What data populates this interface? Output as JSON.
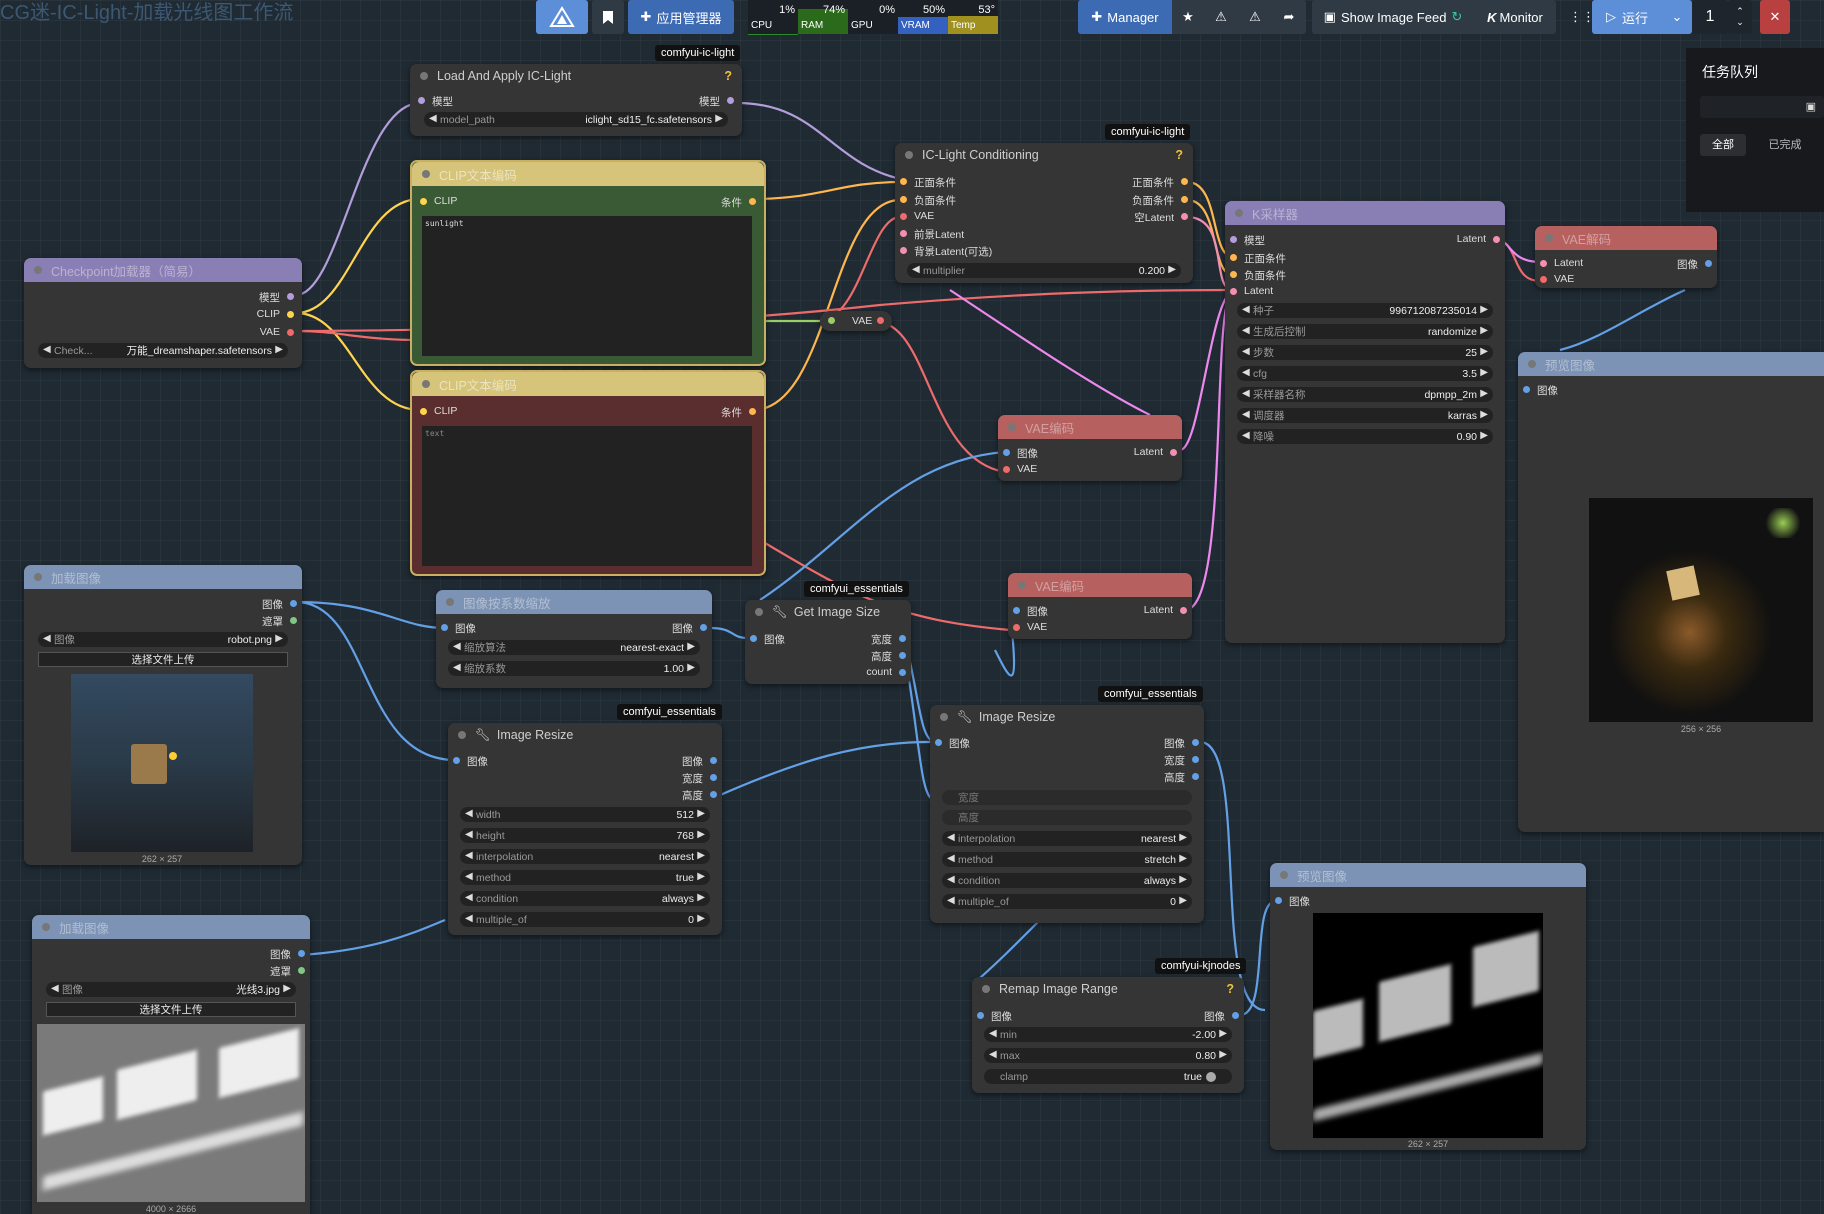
{
  "workflow_title": "CG迷-IC-Light-加载光线图工作流",
  "topbar": {
    "app_manager": "应用管理器",
    "stats": [
      {
        "label": "CPU",
        "value": "1%",
        "level": 0.01,
        "color": "#2a8a2a"
      },
      {
        "label": "RAM",
        "value": "74%",
        "level": 0.74,
        "color": "#2a7a2a"
      },
      {
        "label": "GPU",
        "value": "0%",
        "level": 0.0,
        "color": "#2a7a2a"
      },
      {
        "label": "VRAM",
        "value": "50%",
        "level": 0.5,
        "color": "#3460c0"
      },
      {
        "label": "Temp",
        "value": "53°",
        "level": 0.53,
        "color": "#a09020"
      }
    ],
    "manager": "Manager",
    "show_image_feed": "Show Image Feed",
    "monitor": "Monitor",
    "run": "运行",
    "queue_count": "1"
  },
  "queue_panel": {
    "title": "任务队列",
    "tab_all": "全部",
    "tab_done": "已完成"
  },
  "nodes": {
    "load_iclight": {
      "badge": "comfyui-ic-light",
      "title": "Load And Apply IC-Light",
      "in_model": "模型",
      "out_model": "模型",
      "w_name": "model_path",
      "w_value": "iclight_sd15_fc.safetensors"
    },
    "clip_pos": {
      "title": "CLIP文本编码",
      "in_clip": "CLIP",
      "out": "条件",
      "text": "sunlight"
    },
    "clip_neg": {
      "title": "CLIP文本编码",
      "in_clip": "CLIP",
      "out": "条件",
      "text": "text"
    },
    "checkpoint": {
      "title": "Checkpoint加载器（简易）",
      "out_model": "模型",
      "out_clip": "CLIP",
      "out_vae": "VAE",
      "w_name": "Check...",
      "w_value": "万能_dreamshaper.safetensors"
    },
    "iclight_cond": {
      "badge": "comfyui-ic-light",
      "title": "IC-Light Conditioning",
      "in_pos": "正面条件",
      "in_neg": "负面条件",
      "in_vae": "VAE",
      "in_fg": "前景Latent",
      "in_bg": "背景Latent(可选)",
      "out_pos": "正面条件",
      "out_neg": "负面条件",
      "out_empty": "空Latent",
      "w_name": "multiplier",
      "w_value": "0.200"
    },
    "reroute_vae": {
      "label": "VAE"
    },
    "ksampler": {
      "title": "K采样器",
      "in_model": "模型",
      "in_pos": "正面条件",
      "in_neg": "负面条件",
      "in_latent": "Latent",
      "out_latent": "Latent",
      "widgets": [
        {
          "name": "种子",
          "value": "996712087235014"
        },
        {
          "name": "生成后控制",
          "value": "randomize"
        },
        {
          "name": "步数",
          "value": "25"
        },
        {
          "name": "cfg",
          "value": "3.5"
        },
        {
          "name": "采样器名称",
          "value": "dpmpp_2m"
        },
        {
          "name": "调度器",
          "value": "karras"
        },
        {
          "name": "降噪",
          "value": "0.90"
        }
      ]
    },
    "vae_decode": {
      "title": "VAE解码",
      "in_latent": "Latent",
      "in_vae": "VAE",
      "out_image": "图像"
    },
    "preview_right": {
      "title": "预览图像",
      "in_image": "图像",
      "caption": "256 × 256"
    },
    "vae_encode1": {
      "title": "VAE编码",
      "in_image": "图像",
      "in_vae": "VAE",
      "out_latent": "Latent"
    },
    "vae_encode2": {
      "title": "VAE编码",
      "in_image": "图像",
      "in_vae": "VAE",
      "out_latent": "Latent"
    },
    "load_image1": {
      "title": "加载图像",
      "out_image": "图像",
      "out_mask": "遮罩",
      "w_name": "图像",
      "w_value": "robot.png",
      "upload": "选择文件上传",
      "caption": "262 × 257"
    },
    "upscale": {
      "title": "图像按系数缩放",
      "in_image": "图像",
      "out_image": "图像",
      "widgets": [
        {
          "name": "缩放算法",
          "value": "nearest-exact"
        },
        {
          "name": "缩放系数",
          "value": "1.00"
        }
      ]
    },
    "get_size": {
      "badge": "comfyui_essentials",
      "title": "Get Image Size",
      "in_image": "图像",
      "out_width": "宽度",
      "out_height": "高度",
      "out_count": "count"
    },
    "resize1": {
      "badge": "comfyui_essentials",
      "title": "Image Resize",
      "in_image": "图像",
      "out_image": "图像",
      "out_width": "宽度",
      "out_height": "高度",
      "widgets": [
        {
          "name": "width",
          "value": "512"
        },
        {
          "name": "height",
          "value": "768"
        },
        {
          "name": "interpolation",
          "value": "nearest"
        },
        {
          "name": "method",
          "value": "true"
        },
        {
          "name": "condition",
          "value": "always"
        },
        {
          "name": "multiple_of",
          "value": "0"
        }
      ]
    },
    "resize2": {
      "badge": "comfyui_essentials",
      "title": "Image Resize",
      "in_image": "图像",
      "out_image": "图像",
      "out_width": "宽度",
      "out_height": "高度",
      "in_w": "宽度",
      "in_h": "高度",
      "widgets": [
        {
          "name": "interpolation",
          "value": "nearest"
        },
        {
          "name": "method",
          "value": "stretch"
        },
        {
          "name": "condition",
          "value": "always"
        },
        {
          "name": "multiple_of",
          "value": "0"
        }
      ]
    },
    "load_image2": {
      "title": "加载图像",
      "out_image": "图像",
      "out_mask": "遮罩",
      "w_name": "图像",
      "w_value": "光线3.jpg",
      "upload": "选择文件上传",
      "caption": "4000 × 2666"
    },
    "remap": {
      "badge": "comfyui-kjnodes",
      "title": "Remap Image Range",
      "in_image": "图像",
      "out_image": "图像",
      "widgets": [
        {
          "name": "min",
          "value": "-2.00"
        },
        {
          "name": "max",
          "value": "0.80"
        }
      ],
      "clamp_name": "clamp",
      "clamp_value": "true"
    },
    "preview_mid": {
      "title": "预览图像",
      "in_image": "图像",
      "caption": "262 × 257"
    }
  }
}
